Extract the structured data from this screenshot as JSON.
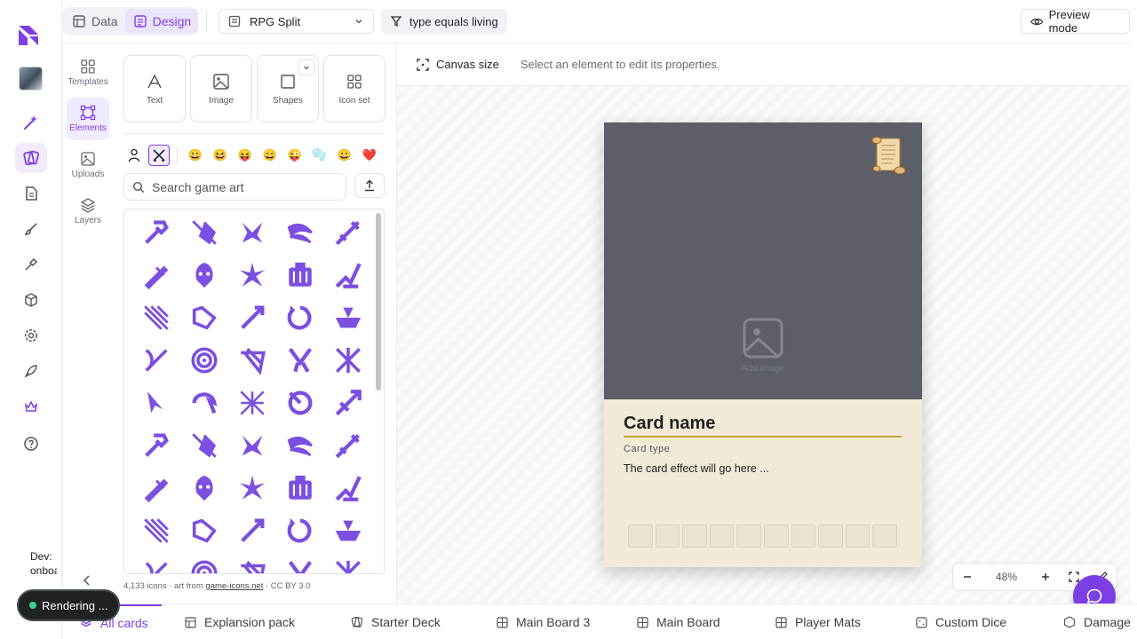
{
  "nav": {
    "mode_tabs": [
      {
        "label": "Data",
        "icon": "table-icon"
      },
      {
        "label": "Design",
        "icon": "design-icon"
      }
    ],
    "template_select": "RPG Split",
    "filter": "type equals living",
    "preview": "Preview mode"
  },
  "side_tabs": {
    "templates": "Templates",
    "elements": "Elements",
    "uploads": "Uploads",
    "layers": "Layers"
  },
  "tools": {
    "text": "Text",
    "image": "Image",
    "shapes": "Shapes",
    "icon_set": "Icon set"
  },
  "search": {
    "placeholder": "Search game art"
  },
  "credit": {
    "count": "4,133 icons · art from ",
    "link": "game-icons.net",
    "license": " · CC BY 3.0"
  },
  "emoji_sets": [
    "😀",
    "😆",
    "😝",
    "😄",
    "😜",
    "🫧",
    "😀",
    "❤️"
  ],
  "properties_bar": {
    "canvas_size": "Canvas size",
    "hint": "Select an element to edit its properties."
  },
  "card": {
    "name": "Card name",
    "type": "Card type",
    "effect": "The card effect will go here ...",
    "image_placeholder": "Add image",
    "slots": 10
  },
  "zoom": {
    "level": "48%"
  },
  "dev": {
    "line1": "Dev:",
    "line2": "onboa"
  },
  "toast": {
    "label": "Rendering ..."
  },
  "bottom_tabs": [
    {
      "label": "All cards"
    },
    {
      "label": "Explansion pack"
    },
    {
      "label": "Starter Deck"
    },
    {
      "label": "Main Board 3"
    },
    {
      "label": "Main Board"
    },
    {
      "label": "Player Mats"
    },
    {
      "label": "Custom Dice"
    },
    {
      "label": "Damage"
    }
  ],
  "colors": {
    "accent": "#7b3fe4",
    "card_art": "#5c5f66",
    "card_body": "#f1ead9",
    "rule": "#c9a43a"
  }
}
